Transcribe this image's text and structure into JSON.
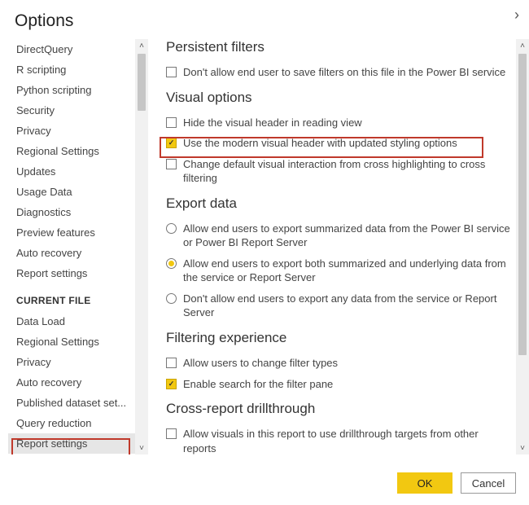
{
  "title": "Options",
  "sidebar": {
    "global_items": [
      "DirectQuery",
      "R scripting",
      "Python scripting",
      "Security",
      "Privacy",
      "Regional Settings",
      "Updates",
      "Usage Data",
      "Diagnostics",
      "Preview features",
      "Auto recovery",
      "Report settings"
    ],
    "current_file_heading": "CURRENT FILE",
    "current_file_items": [
      "Data Load",
      "Regional Settings",
      "Privacy",
      "Auto recovery",
      "Published dataset set...",
      "Query reduction",
      "Report settings"
    ]
  },
  "content": {
    "persistent_filters": {
      "title": "Persistent filters",
      "items": [
        {
          "type": "checkbox",
          "checked": false,
          "label": "Don't allow end user to save filters on this file in the Power BI service"
        }
      ]
    },
    "visual_options": {
      "title": "Visual options",
      "items": [
        {
          "type": "checkbox",
          "checked": false,
          "label": "Hide the visual header in reading view"
        },
        {
          "type": "checkbox",
          "checked": true,
          "label": "Use the modern visual header with updated styling options"
        },
        {
          "type": "checkbox",
          "checked": false,
          "label": "Change default visual interaction from cross highlighting to cross filtering"
        }
      ]
    },
    "export_data": {
      "title": "Export data",
      "items": [
        {
          "type": "radio",
          "checked": false,
          "label": "Allow end users to export summarized data from the Power BI service or Power BI Report Server"
        },
        {
          "type": "radio",
          "checked": true,
          "label": "Allow end users to export both summarized and underlying data from the service or Report Server"
        },
        {
          "type": "radio",
          "checked": false,
          "label": "Don't allow end users to export any data from the service or Report Server"
        }
      ]
    },
    "filtering_experience": {
      "title": "Filtering experience",
      "items": [
        {
          "type": "checkbox",
          "checked": false,
          "label": "Allow users to change filter types"
        },
        {
          "type": "checkbox",
          "checked": true,
          "label": "Enable search for the filter pane"
        }
      ]
    },
    "cross_report": {
      "title": "Cross-report drillthrough",
      "items": [
        {
          "type": "checkbox",
          "checked": false,
          "label": "Allow visuals in this report to use drillthrough targets from other reports"
        }
      ]
    }
  },
  "buttons": {
    "ok": "OK",
    "cancel": "Cancel"
  }
}
